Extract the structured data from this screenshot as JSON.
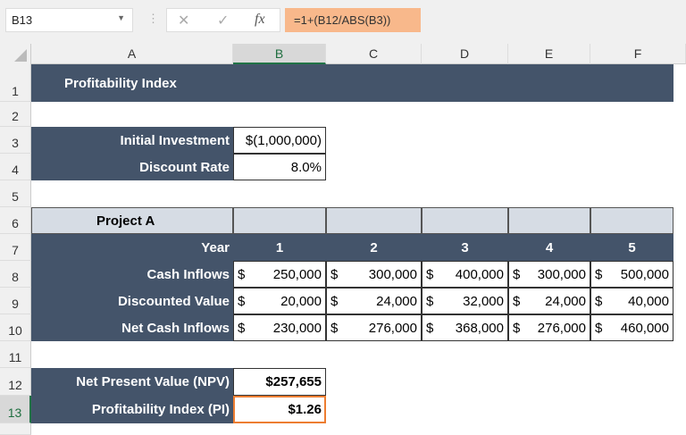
{
  "name_box": "B13",
  "formula": "=1+(B12/ABS(B3))",
  "columns": [
    "A",
    "B",
    "C",
    "D",
    "E",
    "F"
  ],
  "rows": [
    "1",
    "2",
    "3",
    "4",
    "5",
    "6",
    "7",
    "8",
    "9",
    "10",
    "11",
    "12",
    "13"
  ],
  "title": "Profitability Index",
  "initial_investment": {
    "label": "Initial Investment",
    "value": "$(1,000,000)"
  },
  "discount_rate": {
    "label": "Discount Rate",
    "value": "8.0%"
  },
  "project": "Project A",
  "year": {
    "label": "Year",
    "values": [
      "1",
      "2",
      "3",
      "4",
      "5"
    ]
  },
  "cash_inflows": {
    "label": "Cash Inflows",
    "values": [
      "250,000",
      "300,000",
      "400,000",
      "300,000",
      "500,000"
    ]
  },
  "discounted_value": {
    "label": "Discounted Value",
    "values": [
      "20,000",
      "24,000",
      "32,000",
      "24,000",
      "40,000"
    ]
  },
  "net_cash_inflows": {
    "label": "Net Cash Inflows",
    "values": [
      "230,000",
      "276,000",
      "368,000",
      "276,000",
      "460,000"
    ]
  },
  "currency": "$",
  "npv": {
    "label": "Net Present Value (NPV)",
    "value": "$257,655"
  },
  "pi": {
    "label": "Profitability Index (PI)",
    "value": "$1.26"
  }
}
